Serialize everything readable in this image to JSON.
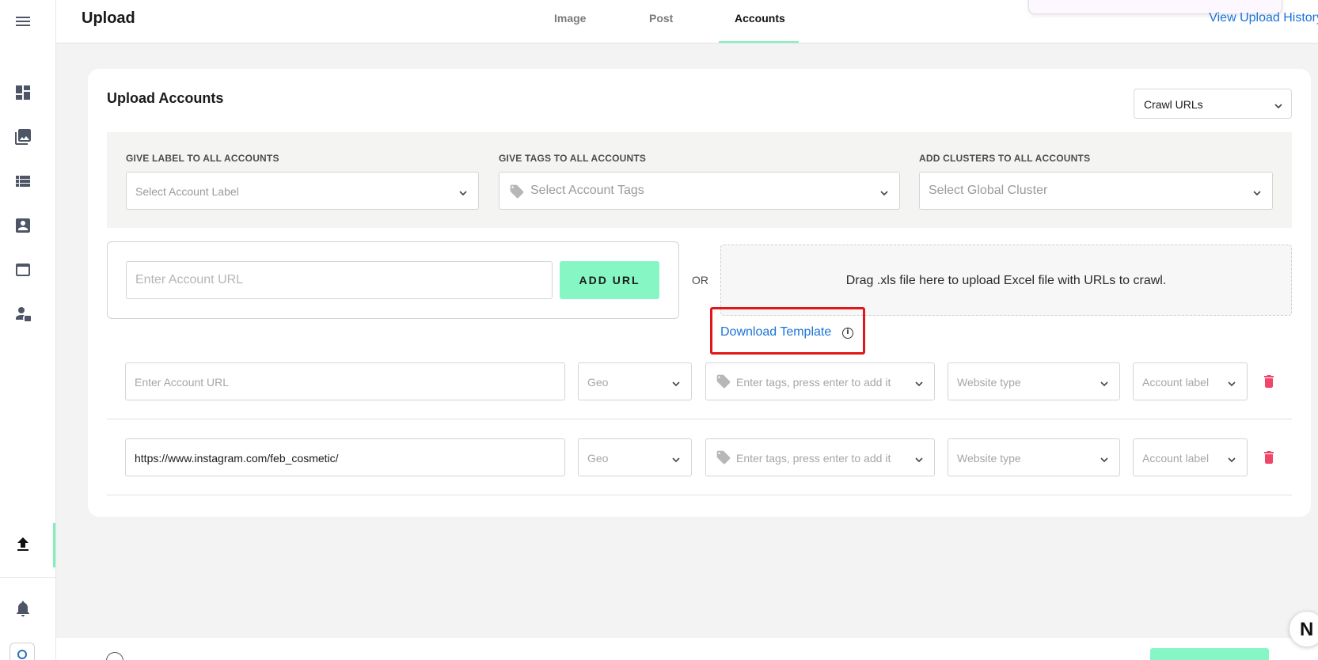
{
  "header": {
    "title": "Upload",
    "tabs": [
      {
        "label": "Image"
      },
      {
        "label": "Post"
      },
      {
        "label": "Accounts"
      }
    ],
    "active_tab": "Accounts",
    "history_link": "View Upload History"
  },
  "sidebar": {
    "items": [
      {
        "icon": "menu-icon"
      },
      {
        "icon": "dashboard-icon"
      },
      {
        "icon": "gallery-icon"
      },
      {
        "icon": "list-icon"
      },
      {
        "icon": "account-box-icon"
      },
      {
        "icon": "browser-window-icon"
      },
      {
        "icon": "user-settings-icon"
      },
      {
        "icon": "upload-icon",
        "active": true
      },
      {
        "icon": "bell-icon"
      }
    ],
    "accent_color": "#7ff0bb"
  },
  "card": {
    "title": "Upload Accounts",
    "mode_select": "Crawl URLs",
    "global": {
      "label_heading": "GIVE LABEL TO ALL ACCOUNTS",
      "label_placeholder": "Select Account Label",
      "tags_heading": "GIVE TAGS TO ALL ACCOUNTS",
      "tags_placeholder": "Select Account Tags",
      "clusters_heading": "ADD CLUSTERS TO ALL ACCOUNTS",
      "clusters_placeholder": "Select Global Cluster"
    },
    "add_url": {
      "placeholder": "Enter Account URL",
      "button": "ADD URL",
      "or": "OR"
    },
    "dropzone_text": "Drag .xls file here to upload Excel file with URLs to crawl.",
    "download_template": "Download Template",
    "rows": [
      {
        "url_value": "",
        "url_placeholder": "Enter Account URL",
        "geo": "Geo",
        "tags_placeholder": "Enter tags, press enter to add it",
        "website_type": "Website type",
        "account_label": "Account label"
      },
      {
        "url_value": "https://www.instagram.com/feb_cosmetic/",
        "url_placeholder": "Enter Account URL",
        "geo": "Geo",
        "tags_placeholder": "Enter tags, press enter to add it",
        "website_type": "Website type",
        "account_label": "Account label"
      }
    ]
  },
  "fab_letter": "N",
  "colors": {
    "primary_button": "#86f7c4",
    "link": "#1a73d9",
    "highlight_box": "#e0161a",
    "delete": "#f0466a"
  }
}
